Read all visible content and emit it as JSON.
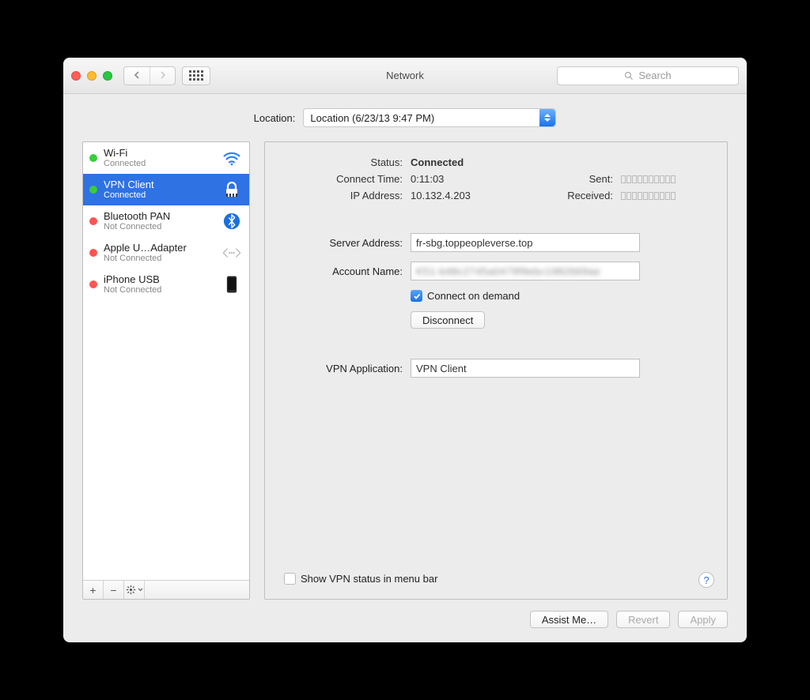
{
  "window": {
    "title": "Network",
    "search_placeholder": "Search"
  },
  "location": {
    "label": "Location:",
    "value": "Location (6/23/13 9:47 PM)"
  },
  "sidebar": {
    "items": [
      {
        "name": "Wi-Fi",
        "status": "Connected",
        "dot": "green",
        "icon": "wifi"
      },
      {
        "name": "VPN Client",
        "status": "Connected",
        "dot": "green",
        "icon": "lock",
        "selected": true
      },
      {
        "name": "Bluetooth PAN",
        "status": "Not Connected",
        "dot": "red",
        "icon": "bluetooth"
      },
      {
        "name": "Apple U…Adapter",
        "status": "Not Connected",
        "dot": "red",
        "icon": "ethernet"
      },
      {
        "name": "iPhone USB",
        "status": "Not Connected",
        "dot": "red",
        "icon": "iphone"
      }
    ]
  },
  "detail": {
    "status_label": "Status:",
    "status_value": "Connected",
    "connect_time_label": "Connect Time:",
    "connect_time_value": "0:11:03",
    "ip_label": "IP Address:",
    "ip_value": "10.132.4.203",
    "sent_label": "Sent:",
    "received_label": "Received:",
    "server_label": "Server Address:",
    "server_value": "fr-sbg.toppeopleverse.top",
    "account_label": "Account Name:",
    "account_value": "K51-b48c2745a0479f9ebc1982669ae",
    "connect_on_demand": "Connect on demand",
    "disconnect": "Disconnect",
    "vpn_app_label": "VPN Application:",
    "vpn_app_value": "VPN Client",
    "show_menubar": "Show VPN status in menu bar"
  },
  "footer": {
    "assist": "Assist Me…",
    "revert": "Revert",
    "apply": "Apply"
  }
}
